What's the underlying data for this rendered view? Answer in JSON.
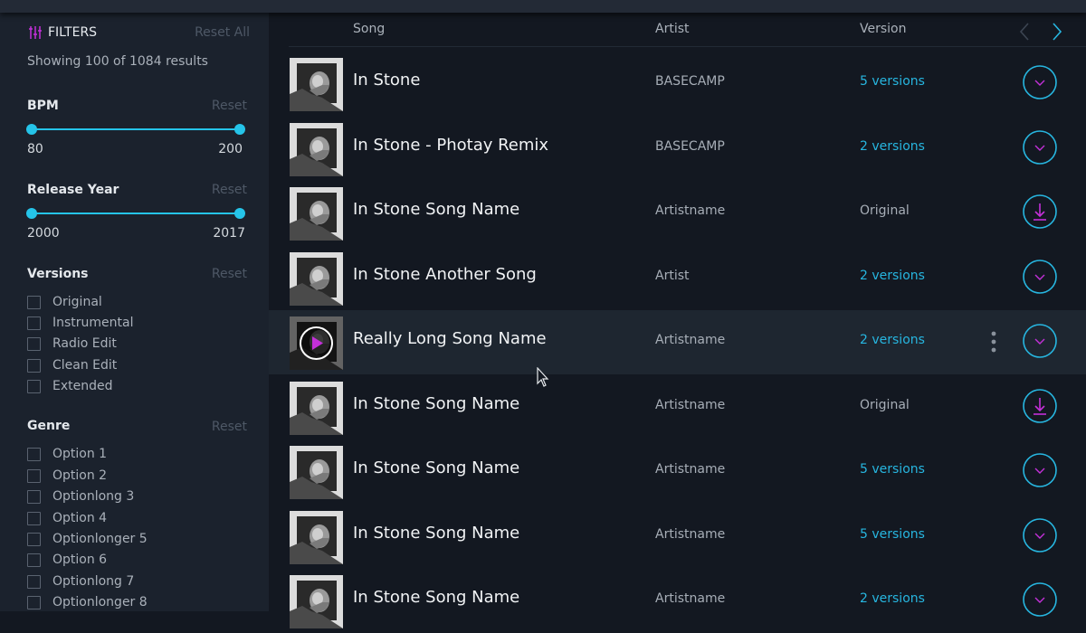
{
  "filters": {
    "title": "FILTERS",
    "reset_all": "Reset All",
    "showing": "Showing 100 of 1084 results",
    "icon": "sliders-icon"
  },
  "bpm": {
    "title": "BPM",
    "reset": "Reset",
    "min": "80",
    "max": "200",
    "selected_fraction": [
      0,
      1
    ]
  },
  "release_year": {
    "title": "Release Year",
    "reset": "Reset",
    "min": "2000",
    "max": "2017",
    "selected_fraction": [
      0,
      1
    ]
  },
  "versions": {
    "title": "Versions",
    "reset": "Reset",
    "options": [
      "Original",
      "Instrumental",
      "Radio Edit",
      "Clean Edit",
      "Extended"
    ]
  },
  "genre": {
    "title": "Genre",
    "reset": "Reset",
    "options": [
      "Option 1",
      "Option 2",
      "Optionlong 3",
      "Option 4",
      "Optionlonger 5",
      "Option 6",
      "Optionlong 7",
      "Optionlonger 8"
    ]
  },
  "table": {
    "headers": {
      "song": "Song",
      "artist": "Artist",
      "version": "Version"
    },
    "rows": [
      {
        "title": "In Stone",
        "artist": "BASECAMP",
        "version": "5 versions",
        "action": "expand"
      },
      {
        "title": "In Stone - Photay Remix",
        "artist": "BASECAMP",
        "version": "2 versions",
        "action": "expand"
      },
      {
        "title": "In Stone Song Name",
        "artist": "Artistname",
        "version": "Original",
        "action": "download"
      },
      {
        "title": "In Stone Another Song",
        "artist": "Artist",
        "version": "2 versions",
        "action": "expand"
      },
      {
        "title": "Really Long Song Name",
        "artist": "Artistname",
        "version": "2 versions",
        "action": "expand",
        "hovered": true
      },
      {
        "title": "In Stone Song Name",
        "artist": "Artistname",
        "version": "Original",
        "action": "download"
      },
      {
        "title": "In Stone Song Name",
        "artist": "Artistname",
        "version": "5 versions",
        "action": "expand"
      },
      {
        "title": "In Stone Song Name",
        "artist": "Artistname",
        "version": "5 versions",
        "action": "expand"
      },
      {
        "title": "In Stone Song Name",
        "artist": "Artistname",
        "version": "2 versions",
        "action": "expand"
      }
    ]
  },
  "colors": {
    "accent_cyan": "#25c4e9",
    "link_blue": "#27b6e0",
    "accent_magenta": "#c430d9",
    "sidebar_bg": "#1b222d",
    "main_bg": "#131821"
  }
}
